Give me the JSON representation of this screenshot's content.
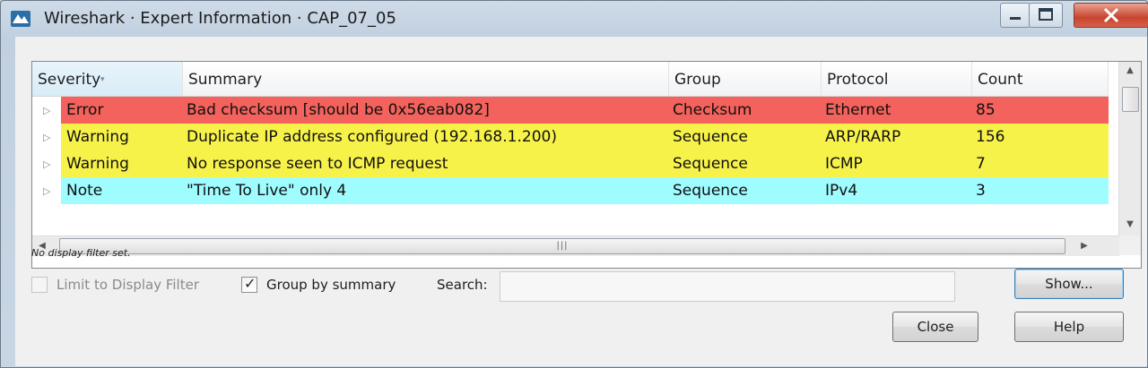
{
  "window": {
    "title": "Wireshark · Expert Information · CAP_07_05",
    "buttons": [
      "minimize-icon",
      "maximize-icon",
      "close-icon"
    ]
  },
  "table": {
    "columns": [
      "Severity",
      "Summary",
      "Group",
      "Protocol",
      "Count"
    ],
    "sorted_column": "Severity",
    "rows": [
      {
        "severity": "Error",
        "summary": "Bad checksum [should be 0x56eab082]",
        "group": "Checksum",
        "protocol": "Ethernet",
        "count": "85",
        "color": "#f3625c"
      },
      {
        "severity": "Warning",
        "summary": "Duplicate IP address configured (192.168.1.200)",
        "group": "Sequence",
        "protocol": "ARP/RARP",
        "count": "156",
        "color": "#f7f24a"
      },
      {
        "severity": "Warning",
        "summary": "No response seen to ICMP request",
        "group": "Sequence",
        "protocol": "ICMP",
        "count": "7",
        "color": "#f7f24a"
      },
      {
        "severity": "Note",
        "summary": "\"Time To Live\" only 4",
        "group": "Sequence",
        "protocol": "IPv4",
        "count": "3",
        "color": "#9ffcff"
      }
    ]
  },
  "status": {
    "filter_text": "No display filter set."
  },
  "options": {
    "limit_label": "Limit to Display Filter",
    "limit_checked": false,
    "limit_enabled": false,
    "group_label": "Group by summary",
    "group_checked": true,
    "search_label": "Search:",
    "search_value": ""
  },
  "buttons": {
    "show": "Show...",
    "close": "Close",
    "help": "Help"
  },
  "colors": {
    "error": "#f3625c",
    "warning": "#f7f24a",
    "note": "#9ffcff"
  }
}
